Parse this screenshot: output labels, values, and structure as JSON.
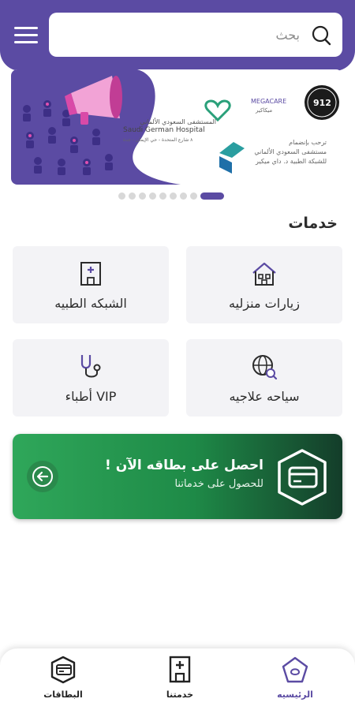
{
  "search": {
    "placeholder": "بحث"
  },
  "banner": {
    "hospital_name_ar": "المستشفى السعودي الألماني",
    "hospital_name_en": "Saudi German Hospital",
    "hospital_address": "٨ شارع المتحدة - حي الإيمان - جدة",
    "welcome_line1": "ترحب بإنضمام",
    "welcome_line2": "مستشفى السعودي الألماني",
    "welcome_line3": "للشبكة الطبية د. داي ميكير",
    "megacare": "MEGACARE",
    "megacare_ar": "ميكاكير",
    "badge_number": "912",
    "slides_total": 9,
    "slide_active": 9
  },
  "services": {
    "title": "خدمات",
    "items": [
      {
        "label": "زيارات منزليه",
        "icon": "house-icon"
      },
      {
        "label": "الشبكه الطبيه",
        "icon": "hospital-icon"
      },
      {
        "label": "سياحه علاجيه",
        "icon": "globe-search-icon"
      },
      {
        "label": "VIP أطباء",
        "icon": "stethoscope-icon"
      }
    ]
  },
  "promo": {
    "title": "احصل على بطاقه الآن !",
    "subtitle": "للحصول على خدماتنا"
  },
  "nav": {
    "items": [
      {
        "label": "الرئيسيه",
        "icon": "home-icon",
        "active": true
      },
      {
        "label": "خدمتنا",
        "icon": "hospital-icon",
        "active": false
      },
      {
        "label": "البطاقات",
        "icon": "cards-icon",
        "active": false
      }
    ]
  },
  "colors": {
    "primary": "#5b4ba3",
    "promo_green": "#2fa75a",
    "promo_dark": "#143d2a",
    "card_bg": "#f3f3f6"
  }
}
